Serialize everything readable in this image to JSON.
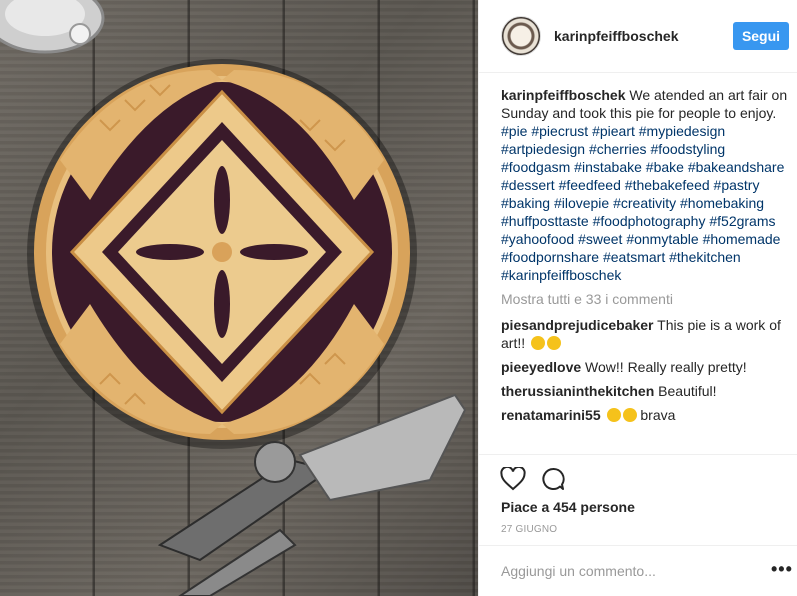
{
  "post": {
    "username": "karinpfeiffboschek",
    "follow_label": "Segui",
    "caption_user": "karinpfeiffboschek",
    "caption_text": "We atended an art fair on Sunday and took this pie for people to enjoy.",
    "hashtags": [
      "#pie",
      "#piecrust",
      "#pieart",
      "#mypiedesign",
      "#artpiedesign",
      "#cherries",
      "#foodstyling",
      "#foodgasm",
      "#instabake",
      "#bake",
      "#bakeandshare",
      "#dessert",
      "#feedfeed",
      "#thebakefeed",
      "#pastry",
      "#baking",
      "#ilovepie",
      "#creativity",
      "#homebaking",
      "#huffposttaste",
      "#foodphotography",
      "#f52grams",
      "#yahoofood",
      "#sweet",
      "#onmytable",
      "#homemade",
      "#foodpornshare",
      "#eatsmart",
      "#thekitchen",
      "#karinpfeiffboschek"
    ],
    "more_comments": "Mostra tutti e 33 i commenti",
    "comments": [
      {
        "user": "piesandprejudicebaker",
        "text": "This pie is a work of art!!"
      },
      {
        "user": "pieeyedlove",
        "text": "Wow!! Really really pretty!"
      },
      {
        "user": "therussianinthekitchen",
        "text": "Beautiful!"
      },
      {
        "user": "renatamarini55",
        "text": "brava"
      }
    ],
    "likes": "Piace a 454 persone",
    "date": "27 GIUGNO",
    "add_comment_placeholder": "Aggiungi un commento...",
    "more_options": "•••"
  },
  "colors": {
    "accent": "#3897f0",
    "hashtag": "#003569",
    "muted": "#999999",
    "text": "#262626"
  },
  "icons": [
    "heart-icon",
    "comment-icon",
    "more-options-icon"
  ]
}
